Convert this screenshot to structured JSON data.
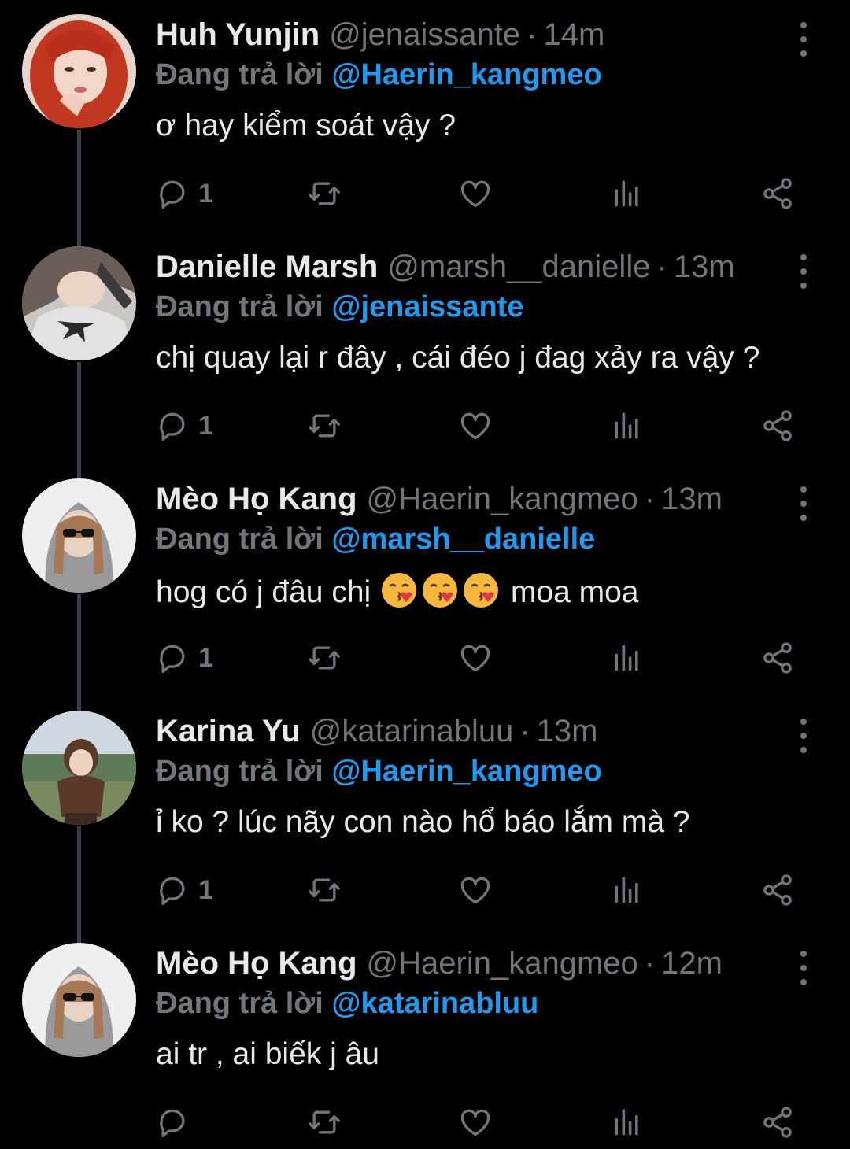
{
  "reply_prefix": "Đang trả lời",
  "separator": "·",
  "tweets": [
    {
      "name": "Huh Yunjin",
      "handle": "@jenaissante",
      "time": "14m",
      "reply_to": "@Haerin_kangmeo",
      "text": "ơ hay kiểm soát vậy ?",
      "reply_count": "1",
      "avatar": "red-haired-woman-avatar"
    },
    {
      "name": "Danielle Marsh",
      "handle": "@marsh__danielle",
      "time": "13m",
      "reply_to": "@jenaissante",
      "text": "chị quay lại r đây , cái đéo j đag xảy ra vậy ?",
      "reply_count": "1",
      "avatar": "woman-lying-down-avatar"
    },
    {
      "name": "Mèo Họ Kang",
      "handle": "@Haerin_kangmeo",
      "time": "13m",
      "reply_to": "@marsh__danielle",
      "text_before_emoji": "hog có j đâu chị",
      "emoji": [
        "kissing-face-emoji",
        "kissing-face-emoji",
        "kissing-face-emoji"
      ],
      "text_after_emoji": "moa moa",
      "reply_count": "1",
      "avatar": "girl-in-hoodie-sunglasses-avatar"
    },
    {
      "name": "Karina Yu",
      "handle": "@katarinabluu",
      "time": "13m",
      "reply_to": "@Haerin_kangmeo",
      "text": "ỉ ko ? lúc nãy con nào hổ báo lắm mà ?",
      "reply_count": "1",
      "avatar": "child-outdoors-avatar"
    },
    {
      "name": "Mèo Họ Kang",
      "handle": "@Haerin_kangmeo",
      "time": "12m",
      "reply_to": "@katarinabluu",
      "text": "ai tr , ai biếk j âu",
      "reply_count": "",
      "avatar": "girl-in-hoodie-sunglasses-avatar"
    }
  ],
  "colors": {
    "background": "#000000",
    "text": "#e7e9ea",
    "muted": "#71767b",
    "mention": "#1d9bf0",
    "thread_line": "#3a4047"
  },
  "icons": [
    "reply-icon",
    "retweet-icon",
    "like-icon",
    "views-icon",
    "share-icon",
    "more-options-icon"
  ]
}
